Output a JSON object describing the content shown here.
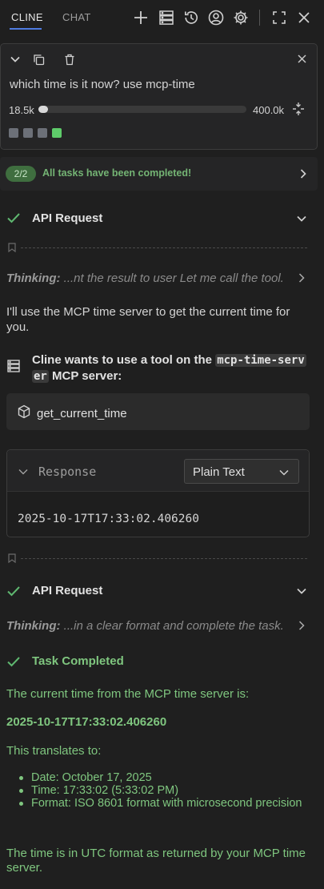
{
  "tabs": {
    "cline": "CLINE",
    "chat": "CHAT"
  },
  "task": {
    "text": "which time is it now? use mcp-time",
    "tokens_used": "18.5k",
    "tokens_max": "400.0k",
    "context_fraction": 0.046,
    "checkpoint_squares": [
      "#6c7078",
      "#6c7078",
      "#6c7078",
      "#5ecb6a"
    ]
  },
  "summary": {
    "badge": "2/2",
    "text": "All tasks have been completed!"
  },
  "messages": {
    "api1_label": "API Request",
    "thinking1_label": "Thinking:",
    "thinking1_text": "...nt the result to user Let me call the tool.",
    "assistant_text": "I'll use the MCP time server to get the current time for you.",
    "tool_intro_prefix": "Cline wants to use a tool on the",
    "tool_server": "mcp-time-serv",
    "tool_server_cont": "er",
    "tool_intro_suffix": "MCP server:",
    "tool_name": "get_current_time",
    "response_label": "Response",
    "response_format": "Plain Text",
    "response_value": "2025-10-17T17:33:02.406260",
    "api2_label": "API Request",
    "thinking2_label": "Thinking:",
    "thinking2_text": "...in a clear format and complete the task.",
    "completed_label": "Task Completed",
    "result_intro": "The current time from the MCP time server is:",
    "result_value": "2025-10-17T17:33:02.406260",
    "translates": "This translates to:",
    "items": [
      "Date: October 17, 2025",
      "Time: 17:33:02 (5:33:02 PM)",
      "Format: ISO 8601 format with microsecond precision"
    ],
    "footer": "The time is in UTC format as returned by your MCP time server."
  },
  "colors": {
    "accent": "#4e7be0",
    "success": "#7fc67f",
    "background": "#1f1f1f"
  }
}
